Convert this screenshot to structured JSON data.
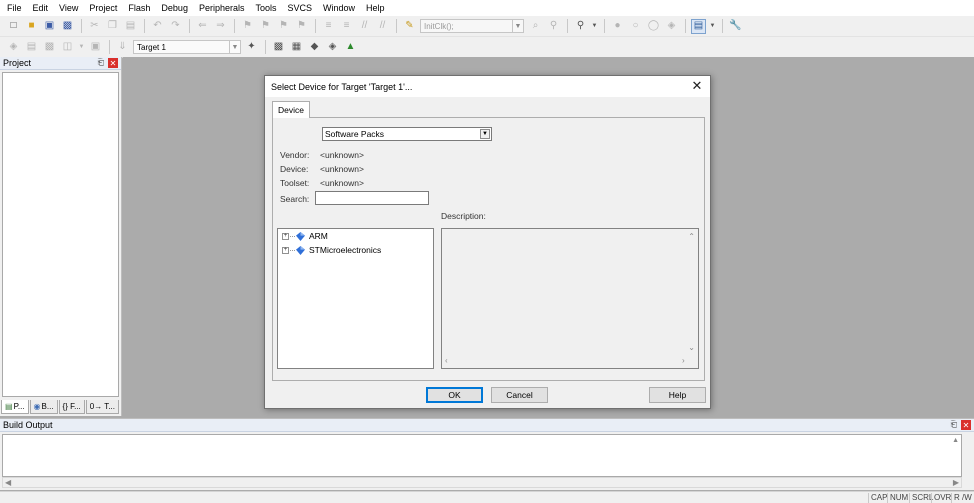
{
  "menubar": {
    "items": [
      "File",
      "Edit",
      "View",
      "Project",
      "Flash",
      "Debug",
      "Peripherals",
      "Tools",
      "SVCS",
      "Window",
      "Help"
    ]
  },
  "toolbar": {
    "function_combo": "InitClk();",
    "target_combo": "Target 1"
  },
  "project_panel": {
    "title": "Project",
    "tabs": [
      "P...",
      "B...",
      "{} F...",
      "0→ T..."
    ]
  },
  "build_panel": {
    "title": "Build Output"
  },
  "statusbar": {
    "cells": [
      "CAP",
      "NUM",
      "SCRL",
      "OVR",
      "R /W"
    ]
  },
  "dialog": {
    "title": "Select Device for Target 'Target 1'...",
    "tab": "Device",
    "pack_select": "Software Packs",
    "vendor_label": "Vendor:",
    "vendor_value": "<unknown>",
    "device_label": "Device:",
    "device_value": "<unknown>",
    "toolset_label": "Toolset:",
    "toolset_value": "<unknown>",
    "search_label": "Search:",
    "search_value": "",
    "description_label": "Description:",
    "tree": [
      {
        "label": "ARM"
      },
      {
        "label": "STMicroelectronics"
      }
    ],
    "ok_label": "OK",
    "cancel_label": "Cancel",
    "help_label": "Help"
  },
  "colors": {
    "workspace": "#ababab",
    "accent": "#0078d7",
    "panel_close": "#d9302c",
    "tree_icon": "#2f6fd8"
  }
}
